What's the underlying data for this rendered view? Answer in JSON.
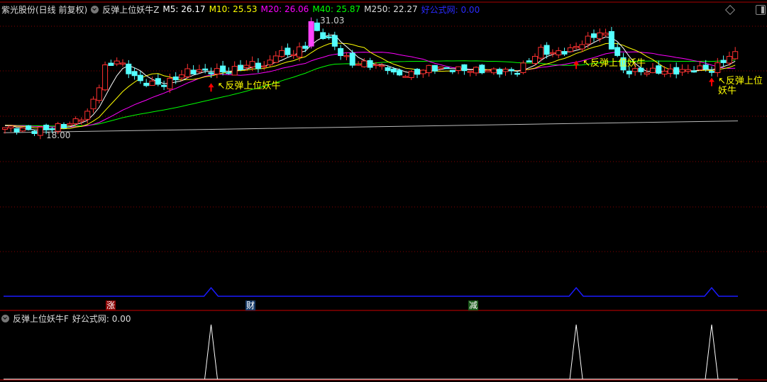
{
  "header": {
    "stock": "紫光股份(日线 前复权)",
    "indicator": "反弹上位妖牛Z",
    "ma": [
      {
        "label": "M5: 26.17",
        "color": "#ffffff"
      },
      {
        "label": "M10: 25.53",
        "color": "#ffff00"
      },
      {
        "label": "M20: 26.06",
        "color": "#ff00ff"
      },
      {
        "label": "M40: 25.87",
        "color": "#00ff00"
      },
      {
        "label": "M250: 22.27",
        "color": "#dddddd"
      }
    ],
    "site": "好公式网: 0.00"
  },
  "annotations": {
    "high": "31.03",
    "low": "18.00",
    "signal": "反弹上位妖牛"
  },
  "badges": [
    {
      "text": "涨",
      "bg": "#8b0000"
    },
    {
      "text": "财",
      "bg": "#1a3d6b"
    },
    {
      "text": "减",
      "bg": "#1a5a1a"
    }
  ],
  "sub_panel": {
    "title": "反弹上位妖牛F",
    "value": "好公式网: 0.00"
  },
  "chart_data": {
    "type": "candlestick",
    "price_range": [
      18.0,
      31.03
    ],
    "control_points": [
      [
        0,
        18.5
      ],
      [
        5,
        18.1
      ],
      [
        11,
        18.9
      ],
      [
        14,
        20.2
      ],
      [
        16,
        23.5
      ],
      [
        17,
        25.6
      ],
      [
        19,
        26.5
      ],
      [
        21,
        25.2
      ],
      [
        23,
        23.9
      ],
      [
        27,
        23.6
      ],
      [
        31,
        25.2
      ],
      [
        35,
        25.2
      ],
      [
        38,
        25.2
      ],
      [
        42,
        26.1
      ],
      [
        44,
        25.6
      ],
      [
        46,
        27.3
      ],
      [
        49,
        27.3
      ],
      [
        51,
        28.2
      ],
      [
        52,
        31.0
      ],
      [
        53,
        29.8
      ],
      [
        55,
        29.0
      ],
      [
        57,
        27.3
      ],
      [
        59,
        26.1
      ],
      [
        61,
        26.1
      ],
      [
        65,
        25.6
      ],
      [
        66,
        24.8
      ],
      [
        69,
        24.8
      ],
      [
        72,
        25.6
      ],
      [
        77,
        25.4
      ],
      [
        84,
        25.2
      ],
      [
        87,
        25.2
      ],
      [
        91,
        27.7
      ],
      [
        93,
        27.3
      ],
      [
        96,
        27.7
      ],
      [
        98,
        28.6
      ],
      [
        101,
        29.8
      ],
      [
        102,
        29.4
      ],
      [
        104,
        26.9
      ],
      [
        105,
        25.2
      ],
      [
        109,
        25.2
      ],
      [
        113,
        25.2
      ],
      [
        115,
        25.2
      ],
      [
        119,
        25.6
      ],
      [
        120,
        25.2
      ],
      [
        122,
        26.5
      ],
      [
        124,
        27.3
      ]
    ],
    "signals": [
      35,
      97,
      120
    ],
    "ma250": [
      17.9,
      19.3
    ]
  }
}
